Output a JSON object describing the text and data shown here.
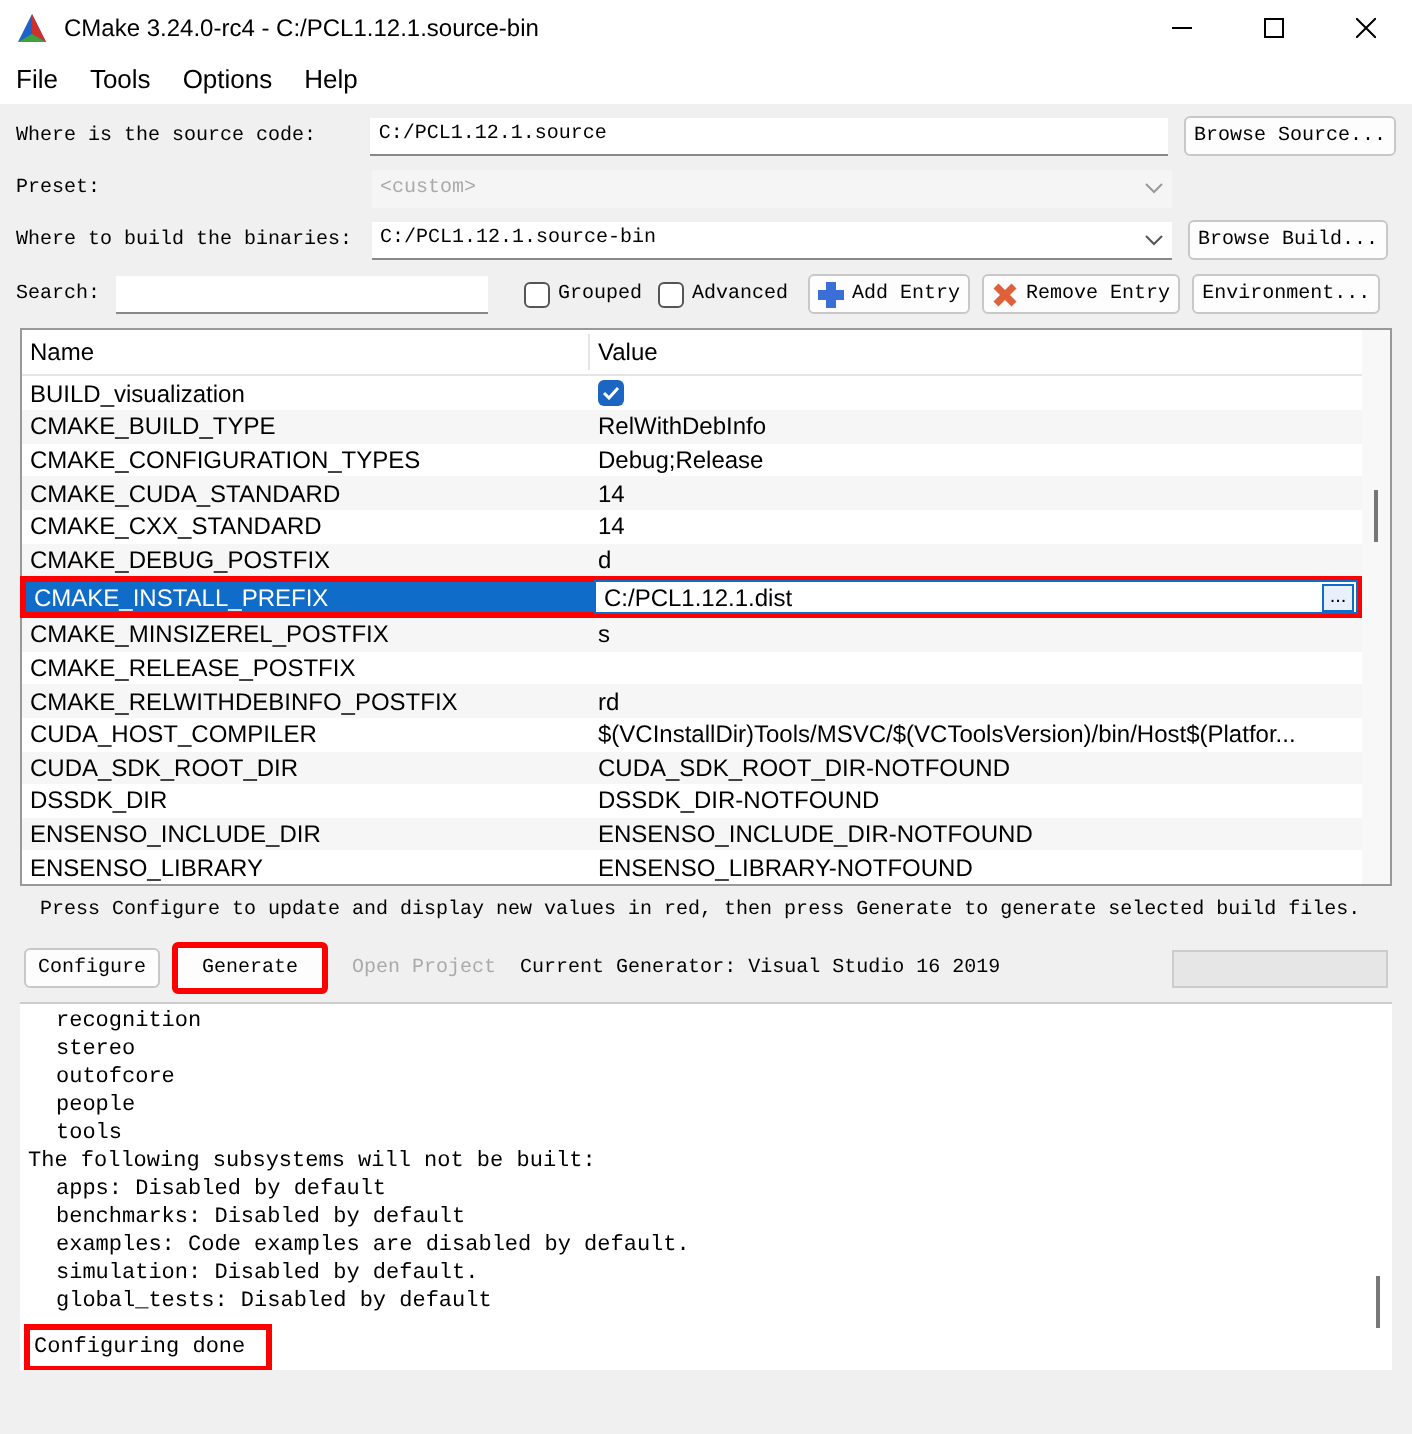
{
  "window": {
    "title": "CMake 3.24.0-rc4 - C:/PCL1.12.1.source-bin"
  },
  "menu": [
    "File",
    "Tools",
    "Options",
    "Help"
  ],
  "form": {
    "source_label": "Where is the source code:",
    "source_value": "C:/PCL1.12.1.source",
    "browse_source": "Browse Source...",
    "preset_label": "Preset:",
    "preset_value": "<custom>",
    "preset_disabled": true,
    "build_label": "Where to build the binaries:",
    "build_value": "C:/PCL1.12.1.source-bin",
    "browse_build": "Browse Build...",
    "search_label": "Search:",
    "grouped": {
      "label": "Grouped",
      "checked": false
    },
    "advanced": {
      "label": "Advanced",
      "checked": false
    },
    "add_entry": "Add Entry",
    "remove_entry": "Remove Entry",
    "environment": "Environment..."
  },
  "table": {
    "columns": [
      "Name",
      "Value"
    ],
    "rows": [
      {
        "name": "BUILD_visualization",
        "kind": "checkbox",
        "checked": true,
        "selected": false,
        "highlighted": false
      },
      {
        "name": "CMAKE_BUILD_TYPE",
        "kind": "text",
        "value": "RelWithDebInfo",
        "selected": false,
        "highlighted": false
      },
      {
        "name": "CMAKE_CONFIGURATION_TYPES",
        "kind": "text",
        "value": "Debug;Release",
        "selected": false,
        "highlighted": false
      },
      {
        "name": "CMAKE_CUDA_STANDARD",
        "kind": "text",
        "value": "14",
        "selected": false,
        "highlighted": false
      },
      {
        "name": "CMAKE_CXX_STANDARD",
        "kind": "text",
        "value": "14",
        "selected": false,
        "highlighted": false
      },
      {
        "name": "CMAKE_DEBUG_POSTFIX",
        "kind": "text",
        "value": "d",
        "selected": false,
        "highlighted": false
      },
      {
        "name": "CMAKE_INSTALL_PREFIX",
        "kind": "path",
        "value": "C:/PCL1.12.1.dist",
        "button": "...",
        "selected": true,
        "highlighted": true
      },
      {
        "name": "CMAKE_MINSIZEREL_POSTFIX",
        "kind": "text",
        "value": "s",
        "selected": false,
        "highlighted": false
      },
      {
        "name": "CMAKE_RELEASE_POSTFIX",
        "kind": "text",
        "selected": false,
        "highlighted": false
      },
      {
        "name": "CMAKE_RELWITHDEBINFO_POSTFIX",
        "kind": "text",
        "value": "rd",
        "selected": false,
        "highlighted": false
      },
      {
        "name": "CUDA_HOST_COMPILER",
        "kind": "text",
        "value": "$(VCInstallDir)Tools/MSVC/$(VCToolsVersion)/bin/Host$(Platfor...",
        "selected": false,
        "highlighted": false
      },
      {
        "name": "CUDA_SDK_ROOT_DIR",
        "kind": "text",
        "value": "CUDA_SDK_ROOT_DIR-NOTFOUND",
        "selected": false,
        "highlighted": false
      },
      {
        "name": "DSSDK_DIR",
        "kind": "text",
        "value": "DSSDK_DIR-NOTFOUND",
        "selected": false,
        "highlighted": false
      },
      {
        "name": "ENSENSO_INCLUDE_DIR",
        "kind": "text",
        "value": "ENSENSO_INCLUDE_DIR-NOTFOUND",
        "selected": false,
        "highlighted": false
      },
      {
        "name": "ENSENSO_LIBRARY",
        "kind": "text",
        "value": "ENSENSO_LIBRARY-NOTFOUND",
        "selected": false,
        "highlighted": false
      }
    ]
  },
  "hint": "Press Configure to update and display new values in red, then press Generate to generate selected build files.",
  "actions": [
    {
      "label": "Configure",
      "disabled": false,
      "highlighted": false
    },
    {
      "label": "Generate",
      "disabled": false,
      "highlighted": true
    },
    {
      "label": "Open Project",
      "disabled": true,
      "highlighted": false
    }
  ],
  "generator": "Current Generator: Visual Studio 16 2019",
  "progress": {
    "level": 0
  },
  "log": [
    {
      "text": "recognition",
      "indented": true,
      "highlighted": false
    },
    {
      "text": "stereo",
      "indented": true,
      "highlighted": false
    },
    {
      "text": "outofcore",
      "indented": true,
      "highlighted": false
    },
    {
      "text": "people",
      "indented": true,
      "highlighted": false
    },
    {
      "text": "tools",
      "indented": true,
      "highlighted": false
    },
    {
      "text": "The following subsystems will not be built:",
      "indented": false,
      "highlighted": false
    },
    {
      "text": "apps: Disabled by default",
      "indented": true,
      "highlighted": false
    },
    {
      "text": "benchmarks: Disabled by default",
      "indented": true,
      "highlighted": false
    },
    {
      "text": "examples: Code examples are disabled by default.",
      "indented": true,
      "highlighted": false
    },
    {
      "text": "simulation: Disabled by default.",
      "indented": true,
      "highlighted": false
    },
    {
      "text": "global_tests: Disabled by default",
      "indented": true,
      "highlighted": false
    },
    {
      "text": "Configuring done",
      "indented": false,
      "highlighted": true
    }
  ]
}
